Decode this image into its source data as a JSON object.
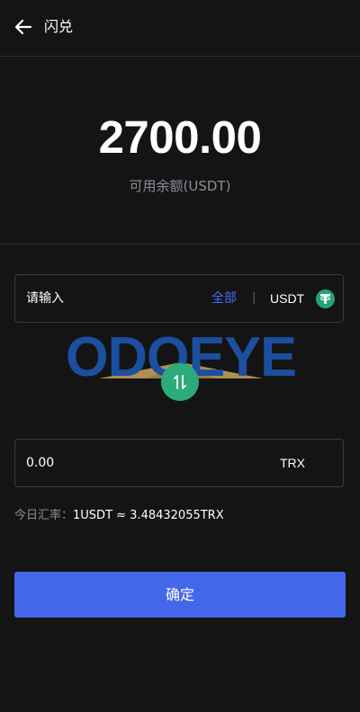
{
  "header": {
    "title": "闪兑",
    "back_icon": "arrow-left-icon"
  },
  "balance": {
    "amount": "2700.00",
    "label": "可用余额(USDT)"
  },
  "from_field": {
    "placeholder": "请输入",
    "all_label": "全部",
    "separator": "|",
    "coin": "USDT",
    "coin_icon": "tether-icon"
  },
  "watermark": {
    "text": "ODOEYE"
  },
  "swap": {
    "icon": "swap-arrows-icon"
  },
  "to_field": {
    "value": "0.00",
    "coin": "TRX"
  },
  "rate": {
    "label": "今日汇率：",
    "value": "1USDT ≈ 3.48432055TRX"
  },
  "confirm_label": "确定",
  "colors": {
    "background": "#141414",
    "accent": "#4466e8",
    "tether_green": "#26a17b",
    "swap_green": "#2bab7b"
  }
}
